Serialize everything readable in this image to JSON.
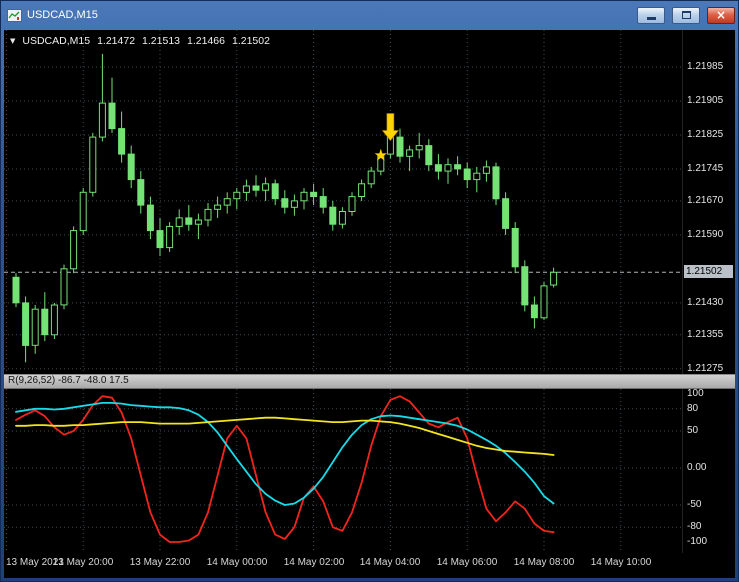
{
  "window": {
    "title": "USDCAD,M15",
    "close_label": "×"
  },
  "chart": {
    "info": {
      "dropdown_icon": "▼",
      "symbol": "USDCAD,M15",
      "open": "1.21472",
      "high": "1.21513",
      "low": "1.21466",
      "close": "1.21502"
    }
  },
  "indicator": {
    "label": "R(9,26,52) -86.7 -48.0 17.5"
  },
  "colors": {
    "background": "#000000",
    "grid": "#3f4a54",
    "bull": "#000000",
    "bear": "#74e274",
    "candle_border": "#74e274",
    "bid_line": "#aeb6ba",
    "bid_label_bg": "#b9c0c7",
    "red_line": "#f2251d",
    "cyan_line": "#17dce8",
    "yellow_line": "#f2e41e",
    "object_gold": "#ffd400",
    "axis_text": "#e4e4e4"
  },
  "chart_data": [
    {
      "type": "candlestick",
      "title": "USDCAD,M15",
      "timeframe": "M15",
      "ohlc_current": {
        "open": 1.21472,
        "high": 1.21513,
        "low": 1.21466,
        "close": 1.21502
      },
      "ylim": [
        1.21263,
        1.22072
      ],
      "grid": true,
      "y_ticks": [
        "1.21985",
        "1.21905",
        "1.21825",
        "1.21745",
        "1.21670",
        "1.21590",
        "1.21430",
        "1.21355",
        "1.21275"
      ],
      "bid": {
        "label": "1.21502",
        "price": 1.21502
      },
      "x_labels": [
        {
          "label": "13 May 2021",
          "bar": -1
        },
        {
          "label": "13 May 20:00",
          "bar": 7
        },
        {
          "label": "13 May 22:00",
          "bar": 15
        },
        {
          "label": "14 May 00:00",
          "bar": 23
        },
        {
          "label": "14 May 02:00",
          "bar": 31
        },
        {
          "label": "14 May 04:00",
          "bar": 39
        },
        {
          "label": "14 May 06:00",
          "bar": 47
        },
        {
          "label": "14 May 08:00",
          "bar": 55
        },
        {
          "label": "14 May 10:00",
          "bar": 63
        }
      ],
      "objects": [
        {
          "type": "arrow-down",
          "bar": 39,
          "price": 1.21812
        },
        {
          "type": "star",
          "bar": 38,
          "price": 1.21778
        }
      ],
      "candles": [
        [
          1.2149,
          1.215,
          1.2142,
          1.2143
        ],
        [
          1.2143,
          1.21445,
          1.2129,
          1.2133
        ],
        [
          1.2133,
          1.21425,
          1.2131,
          1.21415
        ],
        [
          1.21415,
          1.21455,
          1.2134,
          1.21355
        ],
        [
          1.21355,
          1.2143,
          1.21345,
          1.21425
        ],
        [
          1.21425,
          1.2152,
          1.21415,
          1.2151
        ],
        [
          1.2151,
          1.2161,
          1.215,
          1.216
        ],
        [
          1.216,
          1.217,
          1.2159,
          1.2169
        ],
        [
          1.2169,
          1.2183,
          1.2168,
          1.2182
        ],
        [
          1.2182,
          1.22016,
          1.2181,
          1.219
        ],
        [
          1.219,
          1.2196,
          1.2183,
          1.2184
        ],
        [
          1.2184,
          1.2188,
          1.2176,
          1.2178
        ],
        [
          1.2178,
          1.218,
          1.217,
          1.2172
        ],
        [
          1.2172,
          1.2174,
          1.2164,
          1.2166
        ],
        [
          1.2166,
          1.2168,
          1.2158,
          1.216
        ],
        [
          1.216,
          1.2163,
          1.2154,
          1.2156
        ],
        [
          1.2156,
          1.2162,
          1.2155,
          1.2161
        ],
        [
          1.2161,
          1.2165,
          1.2159,
          1.2163
        ],
        [
          1.2163,
          1.2166,
          1.216,
          1.21615
        ],
        [
          1.21615,
          1.2164,
          1.2158,
          1.21625
        ],
        [
          1.21625,
          1.21665,
          1.2161,
          1.2165
        ],
        [
          1.2165,
          1.2168,
          1.2163,
          1.2166
        ],
        [
          1.2166,
          1.2169,
          1.2164,
          1.21675
        ],
        [
          1.21675,
          1.217,
          1.2165,
          1.2169
        ],
        [
          1.2169,
          1.2172,
          1.2167,
          1.21705
        ],
        [
          1.21705,
          1.2173,
          1.2168,
          1.21695
        ],
        [
          1.21695,
          1.21725,
          1.2167,
          1.2171
        ],
        [
          1.2171,
          1.2172,
          1.2166,
          1.21675
        ],
        [
          1.21675,
          1.21695,
          1.2164,
          1.21655
        ],
        [
          1.21655,
          1.21685,
          1.21635,
          1.2167
        ],
        [
          1.2167,
          1.217,
          1.2165,
          1.2169
        ],
        [
          1.2169,
          1.2171,
          1.2166,
          1.2168
        ],
        [
          1.2168,
          1.217,
          1.2164,
          1.21655
        ],
        [
          1.21655,
          1.2167,
          1.216,
          1.21615
        ],
        [
          1.21615,
          1.21655,
          1.21605,
          1.21645
        ],
        [
          1.21645,
          1.2169,
          1.21635,
          1.2168
        ],
        [
          1.2168,
          1.2172,
          1.2167,
          1.2171
        ],
        [
          1.2171,
          1.2175,
          1.217,
          1.2174
        ],
        [
          1.2174,
          1.2179,
          1.2173,
          1.2178
        ],
        [
          1.2178,
          1.21845,
          1.2177,
          1.2182
        ],
        [
          1.2182,
          1.2184,
          1.2176,
          1.21775
        ],
        [
          1.21775,
          1.218,
          1.2174,
          1.2179
        ],
        [
          1.2179,
          1.2183,
          1.2177,
          1.218
        ],
        [
          1.218,
          1.21815,
          1.2174,
          1.21755
        ],
        [
          1.21755,
          1.2178,
          1.2172,
          1.2174
        ],
        [
          1.2174,
          1.2177,
          1.2171,
          1.21755
        ],
        [
          1.21755,
          1.21775,
          1.2173,
          1.21745
        ],
        [
          1.21745,
          1.2176,
          1.217,
          1.2172
        ],
        [
          1.2172,
          1.2175,
          1.2169,
          1.21735
        ],
        [
          1.21735,
          1.21765,
          1.21715,
          1.2175
        ],
        [
          1.2175,
          1.2176,
          1.2166,
          1.21675
        ],
        [
          1.21675,
          1.2169,
          1.2159,
          1.21605
        ],
        [
          1.21605,
          1.2162,
          1.215,
          1.21515
        ],
        [
          1.21515,
          1.2153,
          1.2141,
          1.21425
        ],
        [
          1.21425,
          1.21445,
          1.2137,
          1.21395
        ],
        [
          1.21395,
          1.2148,
          1.2139,
          1.2147
        ],
        [
          1.21472,
          1.21513,
          1.21466,
          1.21502
        ]
      ]
    },
    {
      "type": "line",
      "title": "R(9,26,52) -86.7 -48.0 17.5",
      "ylim": [
        -100,
        100
      ],
      "y_ticks": [
        "100",
        "80",
        "50",
        "0.00",
        "-50",
        "-80",
        "-100"
      ],
      "levels": [
        80,
        50,
        0,
        -50,
        -80
      ],
      "current_values": [
        -86.7,
        -48.0,
        17.5
      ],
      "series": [
        {
          "name": "fast-red",
          "color_key": "red_line",
          "values": [
            65,
            72,
            78,
            70,
            55,
            45,
            50,
            65,
            85,
            97,
            95,
            75,
            40,
            -10,
            -60,
            -90,
            -100,
            -100,
            -98,
            -90,
            -60,
            -10,
            40,
            57,
            40,
            -10,
            -60,
            -90,
            -96,
            -80,
            -40,
            -25,
            -45,
            -80,
            -85,
            -60,
            -20,
            30,
            70,
            92,
            97,
            90,
            75,
            60,
            55,
            62,
            68,
            40,
            -10,
            -55,
            -72,
            -60,
            -45,
            -55,
            -75,
            -85,
            -86.7
          ]
        },
        {
          "name": "medium-cyan",
          "color_key": "cyan_line",
          "values": [
            76,
            78,
            80,
            80,
            79,
            80,
            82,
            84,
            86,
            88,
            88,
            87,
            85,
            84,
            83,
            82,
            82,
            81,
            78,
            72,
            62,
            48,
            30,
            12,
            -5,
            -22,
            -35,
            -44,
            -50,
            -48,
            -40,
            -28,
            -12,
            8,
            28,
            45,
            58,
            66,
            70,
            71,
            70,
            68,
            66,
            64,
            62,
            60,
            57,
            52,
            45,
            38,
            30,
            20,
            8,
            -5,
            -20,
            -38,
            -48
          ]
        },
        {
          "name": "slow-yellow",
          "color_key": "yellow_line",
          "values": [
            57,
            57,
            58,
            58,
            57,
            57,
            58,
            58,
            59,
            60,
            61,
            62,
            62,
            62,
            61,
            60,
            60,
            60,
            60,
            61,
            62,
            63,
            64,
            65,
            66,
            67,
            68,
            68,
            67,
            66,
            65,
            64,
            63,
            62,
            62,
            63,
            64,
            64,
            63,
            62,
            60,
            57,
            54,
            50,
            46,
            42,
            38,
            34,
            30,
            27,
            25,
            23,
            22,
            21,
            20,
            19,
            17.5
          ]
        }
      ]
    }
  ]
}
